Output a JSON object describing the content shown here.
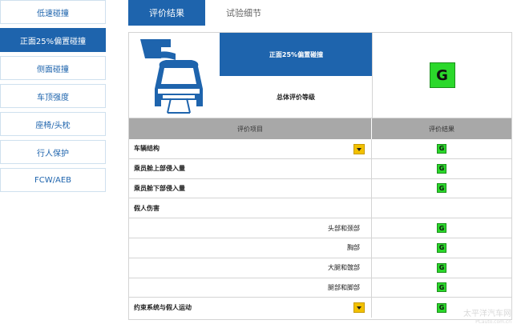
{
  "sidebar": {
    "items": [
      {
        "label": "低速碰撞",
        "active": false
      },
      {
        "label": "正面25%偏置碰撞",
        "active": true
      },
      {
        "label": "侧面碰撞",
        "active": false
      },
      {
        "label": "车顶强度",
        "active": false
      },
      {
        "label": "座椅/头枕",
        "active": false
      },
      {
        "label": "行人保护",
        "active": false
      },
      {
        "label": "FCW/AEB",
        "active": false
      }
    ]
  },
  "tabs": [
    {
      "label": "评价结果",
      "active": true
    },
    {
      "label": "试验细节",
      "active": false
    }
  ],
  "summary": {
    "test_title": "正面25%偏置碰撞",
    "overall_label": "总体评价等级",
    "overall_grade": "G"
  },
  "table": {
    "headers": [
      "评价项目",
      "评价结果"
    ],
    "rows": [
      {
        "item": "车辆结构",
        "grade": "G",
        "level": "main",
        "expandable": true
      },
      {
        "item": "乘员舱上部侵入量",
        "grade": "G",
        "level": "main",
        "expandable": false
      },
      {
        "item": "乘员舱下部侵入量",
        "grade": "G",
        "level": "main",
        "expandable": false
      },
      {
        "item": "假人伤害",
        "grade": "",
        "level": "main",
        "expandable": false
      },
      {
        "item": "头部和颈部",
        "grade": "G",
        "level": "sub",
        "expandable": false
      },
      {
        "item": "胸部",
        "grade": "G",
        "level": "sub",
        "expandable": false
      },
      {
        "item": "大腿和髋部",
        "grade": "G",
        "level": "sub",
        "expandable": false
      },
      {
        "item": "腿部和脚部",
        "grade": "G",
        "level": "sub",
        "expandable": false
      },
      {
        "item": "约束系统与假人运动",
        "grade": "G",
        "level": "main",
        "expandable": true
      }
    ]
  },
  "watermark": {
    "line1": "太平洋汽车网",
    "line2": "PCauto.com.cn"
  },
  "colors": {
    "accent": "#1e64ad",
    "good": "#2bd82b",
    "expand": "#f2c100",
    "header": "#a8a8a8"
  }
}
